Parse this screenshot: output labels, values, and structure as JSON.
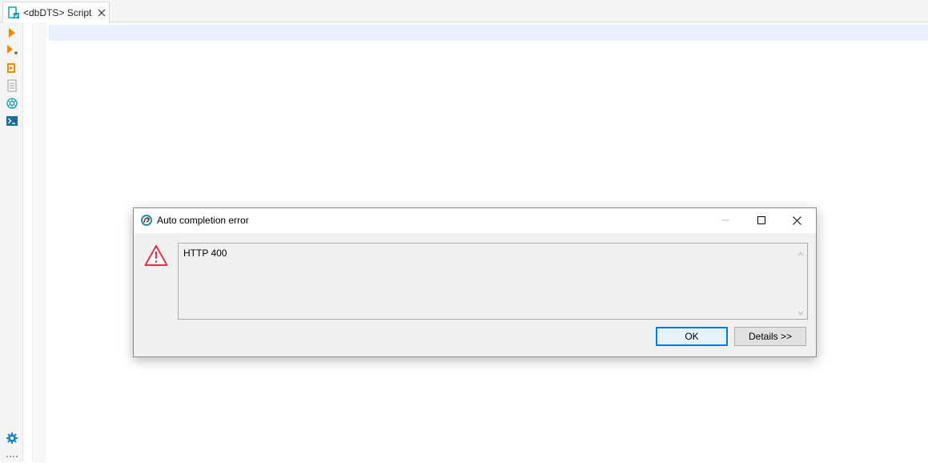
{
  "tab": {
    "label": "<dbDTS> Script"
  },
  "toolstrip": {
    "tools": [
      {
        "icon": "run-icon",
        "tooltip": ""
      },
      {
        "icon": "run-new-icon"
      },
      {
        "icon": "script-icon"
      },
      {
        "icon": "document-icon"
      },
      {
        "icon": "openai-icon"
      },
      {
        "icon": "terminal-icon"
      },
      {
        "icon": "settings-gear-icon"
      },
      {
        "icon": "more-dots-icon"
      }
    ]
  },
  "dialog": {
    "title": "Auto completion error",
    "message": "HTTP 400",
    "ok_label": "OK",
    "details_label": "Details >>"
  },
  "colors": {
    "accent": "#0078d7",
    "run_orange": "#f08b00",
    "teal": "#1a9bab",
    "warning_red": "#d9334b",
    "current_line": "#e8f2fe"
  }
}
